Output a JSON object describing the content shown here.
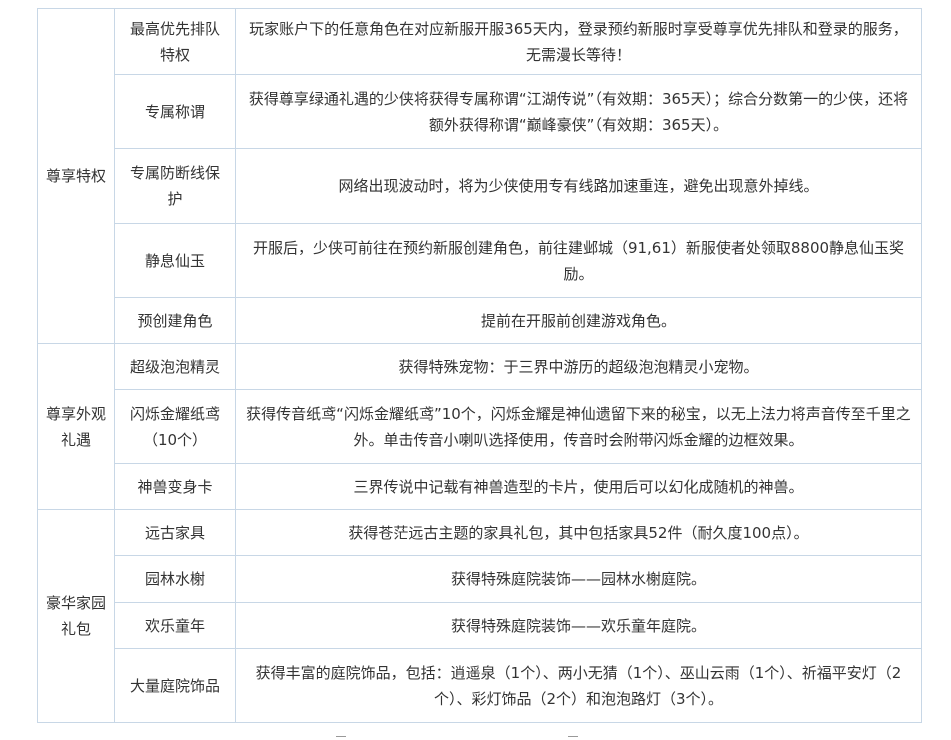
{
  "table": {
    "groups": [
      {
        "name": "尊享特权",
        "rows": [
          {
            "item": "最高优先排队特权",
            "desc": "玩家账户下的任意角色在对应新服开服365天内，登录预约新服时享受尊享优先排队和登录的服务，无需漫长等待！"
          },
          {
            "item": "专属称谓",
            "desc": "获得尊享绿通礼遇的少侠将获得专属称谓“江湖传说”（有效期：365天）；综合分数第一的少侠，还将额外获得称谓“巅峰豪侠”（有效期：365天）。"
          },
          {
            "item": "专属防断线保护",
            "desc": "网络出现波动时，将为少侠使用专有线路加速重连，避免出现意外掉线。"
          },
          {
            "item": "静息仙玉",
            "desc": "开服后，少侠可前往在预约新服创建角色，前往建邺城（91,61）新服使者处领取8800静息仙玉奖励。"
          },
          {
            "item": "预创建角色",
            "desc": "提前在开服前创建游戏角色。"
          }
        ]
      },
      {
        "name": "尊享外观礼遇",
        "rows": [
          {
            "item": "超级泡泡精灵",
            "desc": "获得特殊宠物：于三界中游历的超级泡泡精灵小宠物。"
          },
          {
            "item": "闪烁金耀纸鸢（10个）",
            "desc": "获得传音纸鸢“闪烁金耀纸鸢”10个，闪烁金耀是神仙遗留下来的秘宝，以无上法力将声音传至千里之外。单击传音小喇叭选择使用，传音时会附带闪烁金耀的边框效果。"
          },
          {
            "item": "神兽变身卡",
            "desc": "三界传说中记载有神兽造型的卡片，使用后可以幻化成随机的神兽。"
          }
        ]
      },
      {
        "name": "豪华家园礼包",
        "rows": [
          {
            "item": "远古家具",
            "desc": "获得苍茫远古主题的家具礼包，其中包括家具52件（耐久度100点）。"
          },
          {
            "item": "园林水榭",
            "desc": "获得特殊庭院装饰——园林水榭庭院。"
          },
          {
            "item": "欢乐童年",
            "desc": "获得特殊庭院装饰——欢乐童年庭院。"
          },
          {
            "item": "大量庭院饰品",
            "desc": "获得丰富的庭院饰品，包括：逍遥泉（1个）、两小无猜（1个）、巫山云雨（1个）、祈福平安灯（2个）、彩灯饰品（2个）和泡泡路灯（3个）。"
          }
        ]
      }
    ]
  }
}
